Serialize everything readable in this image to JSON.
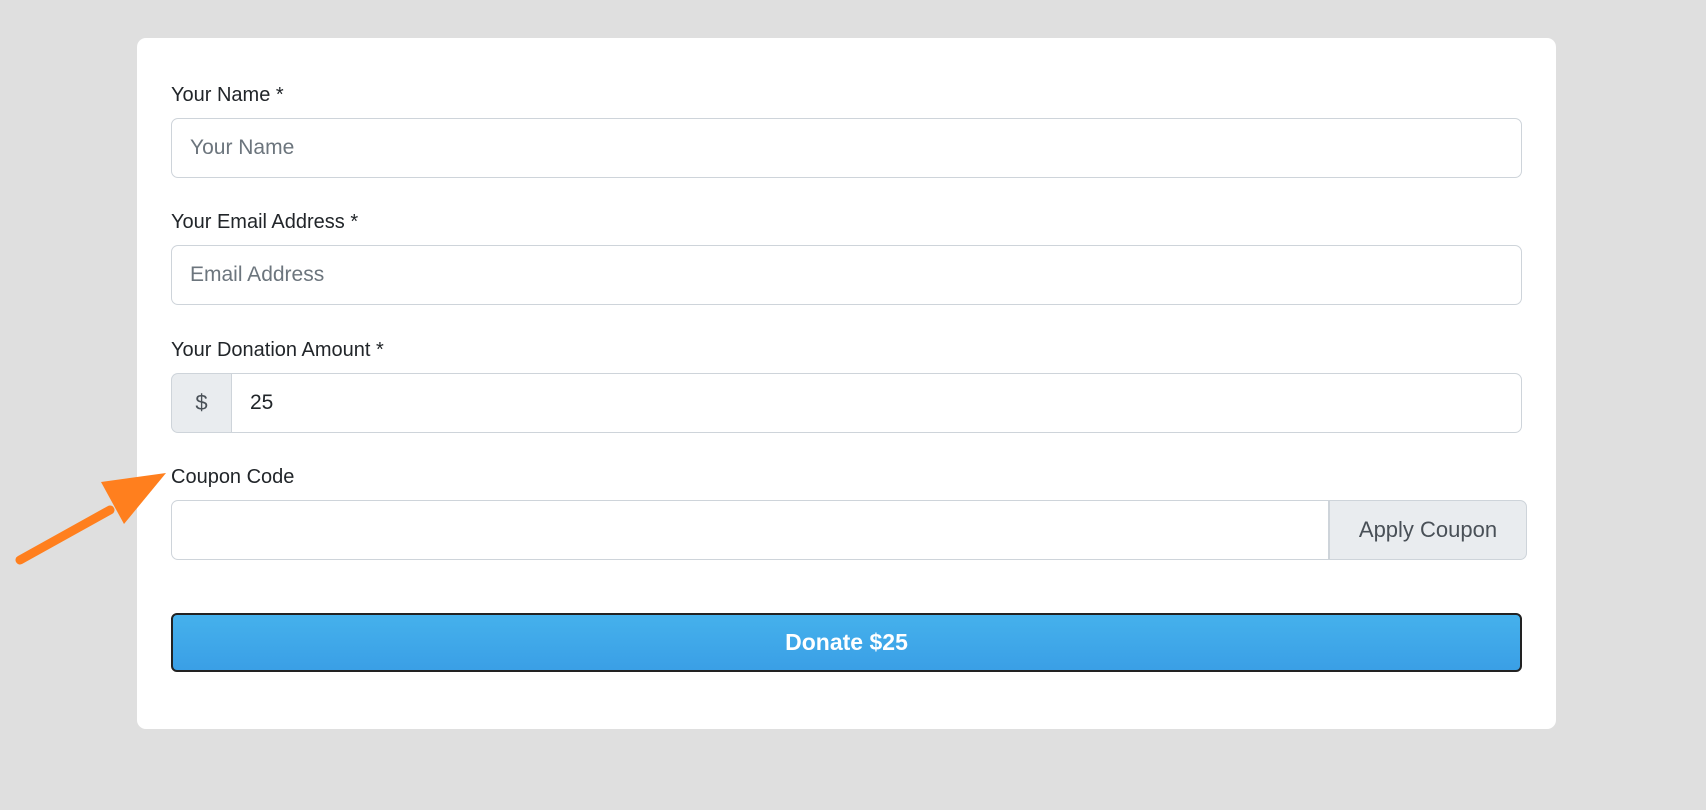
{
  "form": {
    "name": {
      "label": "Your Name *",
      "placeholder": "Your Name",
      "value": ""
    },
    "email": {
      "label": "Your Email Address *",
      "placeholder": "Email Address",
      "value": ""
    },
    "amount": {
      "label": "Your Donation Amount *",
      "currency_symbol": "$",
      "value": "25"
    },
    "coupon": {
      "label": "Coupon Code",
      "value": "",
      "apply_label": "Apply Coupon"
    },
    "donate_label": "Donate $25"
  },
  "colors": {
    "page_background": "#dfdfdf",
    "card_background": "#ffffff",
    "donate_button": "#3ea8ea",
    "annotation_arrow": "#ff7f1e"
  },
  "annotation": {
    "icon": "arrow-icon",
    "points_to": "coupon-code-label"
  }
}
